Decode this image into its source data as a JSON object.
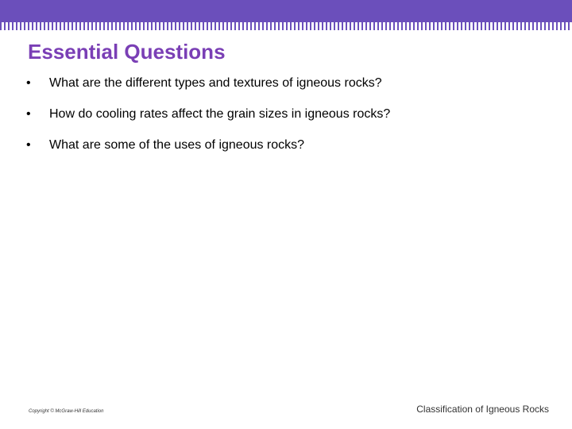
{
  "colors": {
    "banner": "#6b4fbb",
    "title": "#7a3fb5"
  },
  "slide": {
    "title": "Essential Questions",
    "bullet_symbol": "•",
    "bullets": [
      "What are the different types and textures of igneous rocks?",
      "How do cooling rates affect the grain sizes in igneous rocks?",
      "What are some of the uses of igneous rocks?"
    ]
  },
  "footer": {
    "copyright": "Copyright © McGraw-Hill Education",
    "title": "Classification of Igneous Rocks"
  }
}
